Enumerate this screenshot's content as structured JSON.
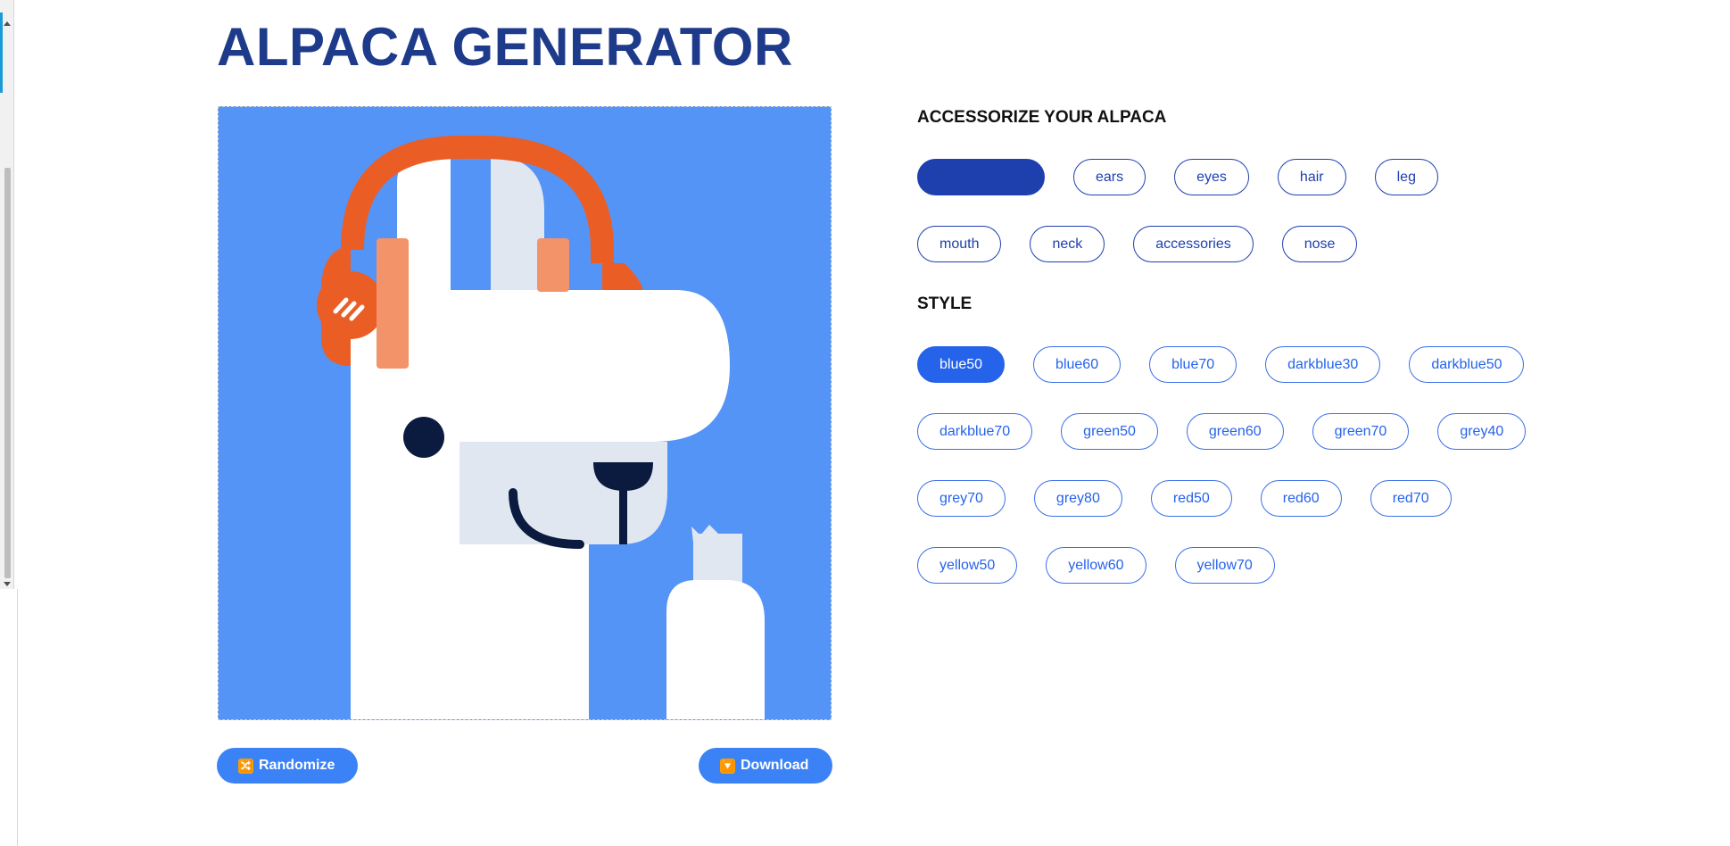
{
  "page": {
    "title": "ALPACA GENERATOR"
  },
  "actions": {
    "randomize_label": "Randomize",
    "randomize_icon": "🔀",
    "download_label": "Download",
    "download_icon": "🔽"
  },
  "accessorize": {
    "heading": "ACCESSORIZE YOUR ALPACA",
    "selected_item_label": "",
    "rows": [
      [
        "",
        "ears",
        "eyes",
        "hair",
        "leg"
      ],
      [
        "mouth",
        "neck",
        "accessories",
        "nose"
      ]
    ]
  },
  "style": {
    "heading": "STYLE",
    "selected": "blue50",
    "rows": [
      [
        "blue50",
        "blue60",
        "blue70",
        "darkblue30",
        "darkblue50"
      ],
      [
        "darkblue70",
        "green50",
        "green60",
        "green70",
        "grey40"
      ],
      [
        "grey70",
        "grey80",
        "red50",
        "red60",
        "red70"
      ],
      [
        "yellow50",
        "yellow60",
        "yellow70"
      ]
    ]
  },
  "colors": {
    "background_blue": "#5494f6",
    "title_navy": "#1e3a8a",
    "headphone_orange": "#ea5e25",
    "headphone_pad": "#f2936a",
    "fur_white": "#ffffff",
    "fur_light": "#e1e7f1",
    "dark_navy": "#0b1b3f",
    "button_blue": "#3b82f6"
  }
}
